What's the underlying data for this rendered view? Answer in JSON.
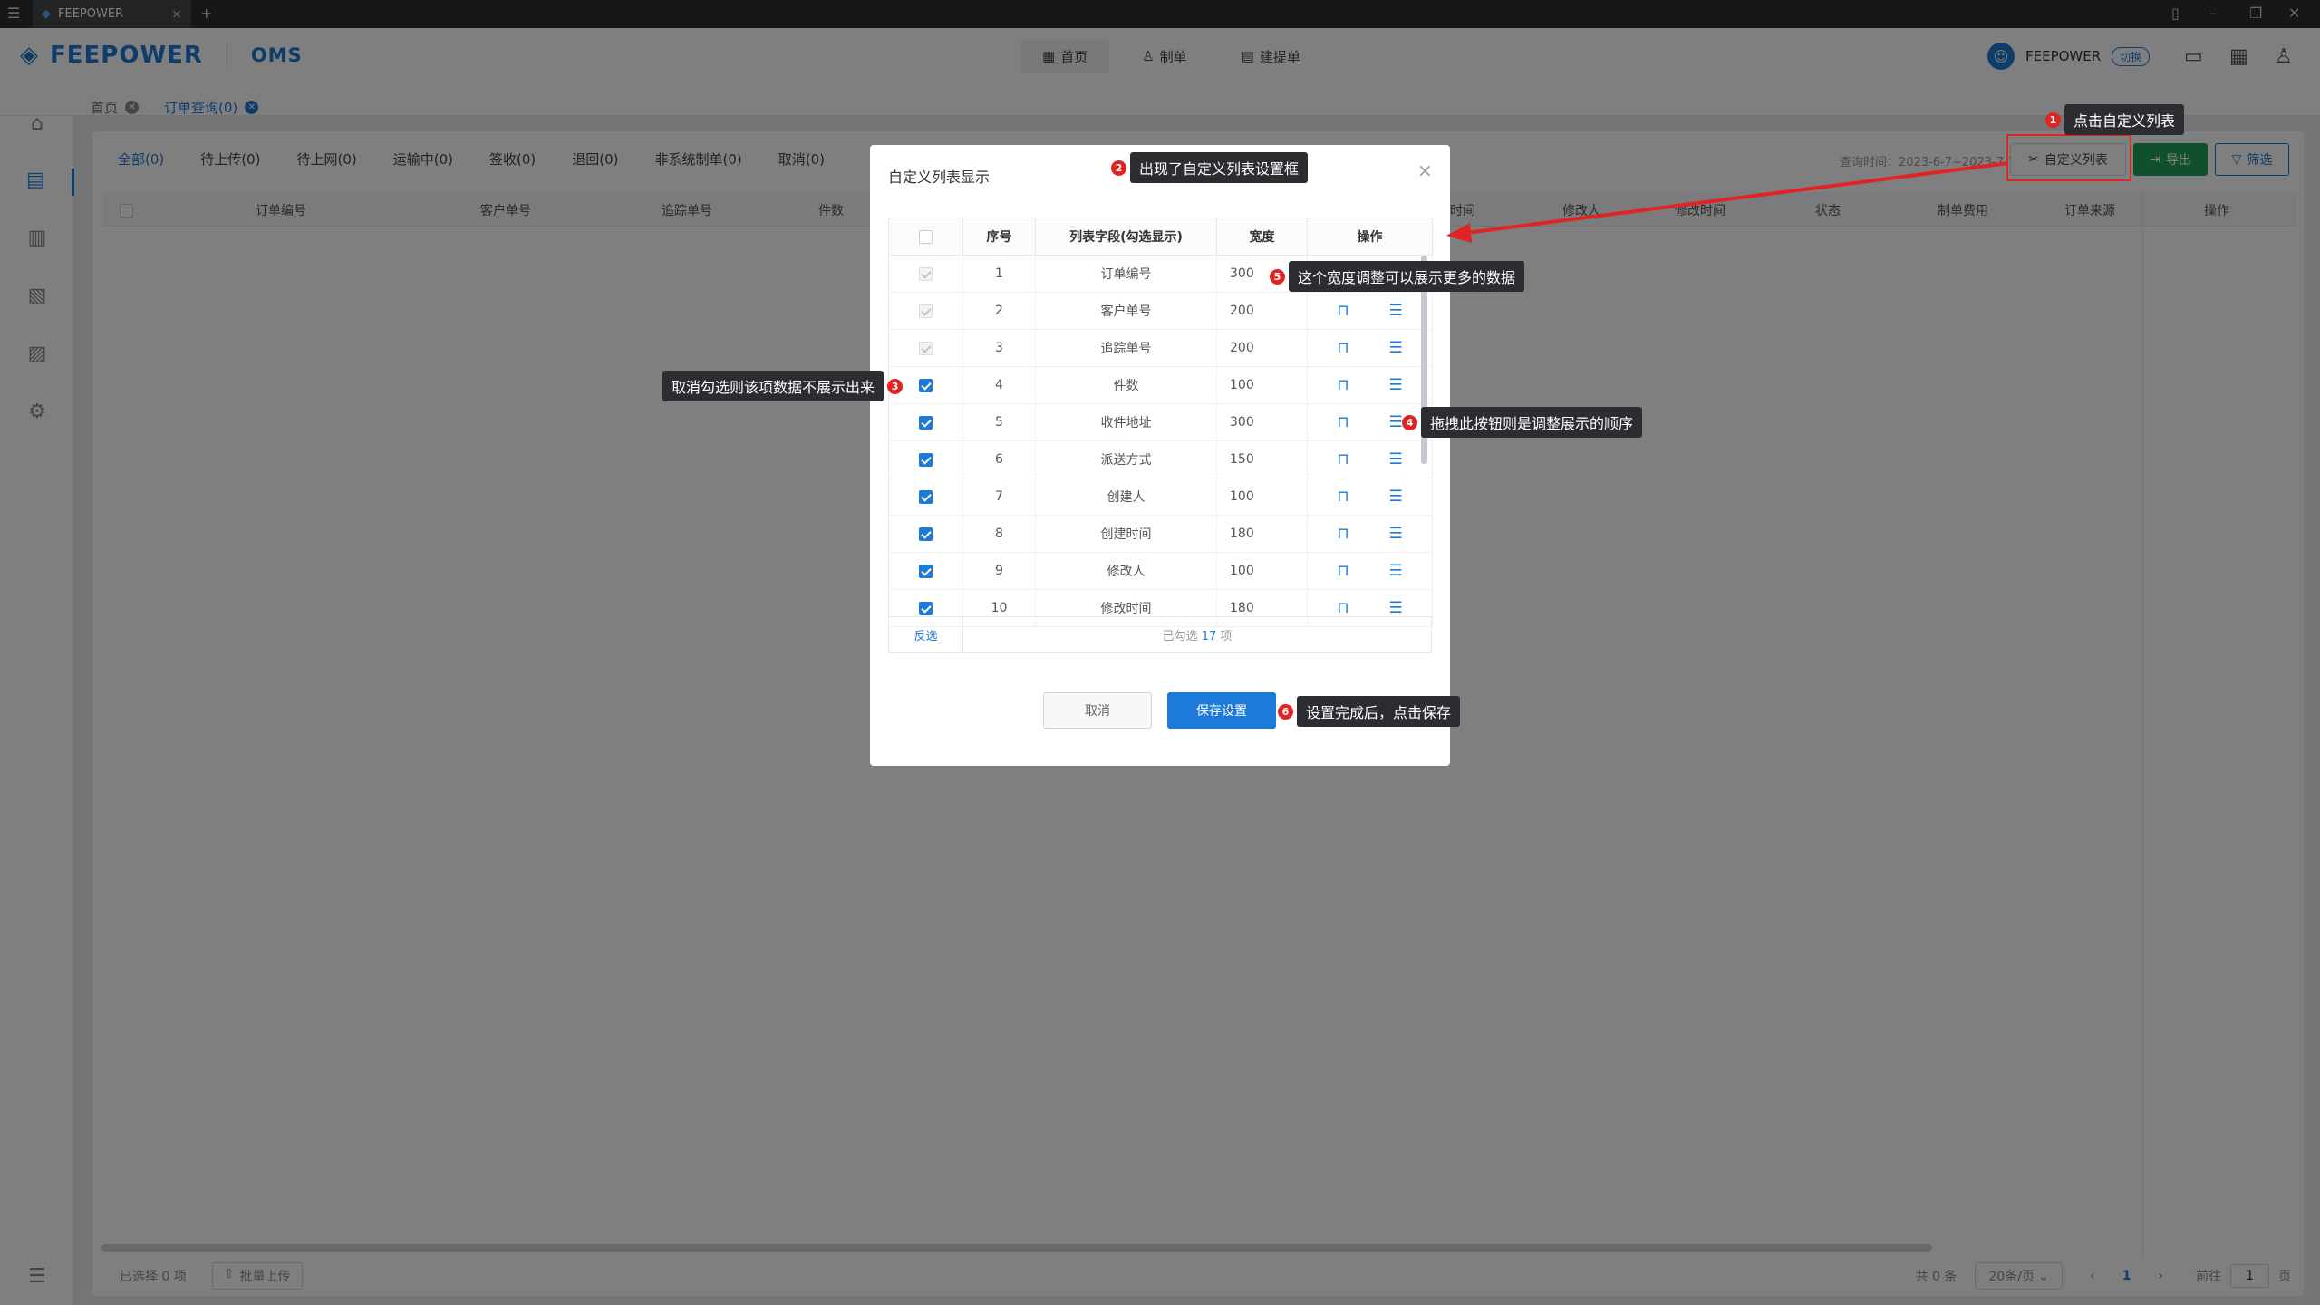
{
  "titlebar": {
    "tab_title": "FEEPOWER",
    "new_tab": "+"
  },
  "header": {
    "brand": "FEEPOWER",
    "app": "OMS",
    "nav": [
      {
        "label": "首页"
      },
      {
        "label": "制单"
      },
      {
        "label": "建提单"
      }
    ],
    "user": "FEEPOWER",
    "switch_label": "切换"
  },
  "breadcrumbs": [
    {
      "label": "首页"
    },
    {
      "label": "订单查询(0)"
    }
  ],
  "filters": [
    "全部(0)",
    "待上传(0)",
    "待上网(0)",
    "运输中(0)",
    "签收(0)",
    "退回(0)",
    "非系统制单(0)",
    "取消(0)"
  ],
  "toolbar": {
    "query_time": "查询时间：2023-6-7~2023-7-7",
    "custom_list": "自定义列表",
    "export": "导出",
    "filter": "筛选"
  },
  "table_headers": [
    "订单编号",
    "客户单号",
    "追踪单号",
    "件数",
    "时间",
    "修改人",
    "修改时间",
    "状态",
    "制单费用",
    "订单来源",
    "操作"
  ],
  "footer": {
    "selected": "已选择 0 项",
    "batch_upload": "批量上传",
    "total": "共 0 条",
    "page_size": "20条/页",
    "current_page": "1",
    "goto": "前往",
    "goto_value": "1",
    "page_suffix": "页"
  },
  "modal": {
    "title": "自定义列表显示",
    "columns": [
      "序号",
      "列表字段(勾选显示)",
      "宽度",
      "操作"
    ],
    "rows": [
      {
        "no": "1",
        "field": "订单编号",
        "width": "300",
        "state": "disabled"
      },
      {
        "no": "2",
        "field": "客户单号",
        "width": "200",
        "state": "disabled"
      },
      {
        "no": "3",
        "field": "追踪单号",
        "width": "200",
        "state": "disabled"
      },
      {
        "no": "4",
        "field": "件数",
        "width": "100",
        "state": "checked"
      },
      {
        "no": "5",
        "field": "收件地址",
        "width": "300",
        "state": "checked"
      },
      {
        "no": "6",
        "field": "派送方式",
        "width": "150",
        "state": "checked"
      },
      {
        "no": "7",
        "field": "创建人",
        "width": "100",
        "state": "checked"
      },
      {
        "no": "8",
        "field": "创建时间",
        "width": "180",
        "state": "checked"
      },
      {
        "no": "9",
        "field": "修改人",
        "width": "100",
        "state": "checked"
      },
      {
        "no": "10",
        "field": "修改时间",
        "width": "180",
        "state": "checked"
      }
    ],
    "invert": "反选",
    "selected_prefix": "已勾选",
    "selected_count": "17",
    "selected_suffix": "项",
    "cancel": "取消",
    "save": "保存设置"
  },
  "annotations": [
    {
      "n": "1",
      "text": "点击自定义列表"
    },
    {
      "n": "2",
      "text": "出现了自定义列表设置框"
    },
    {
      "n": "3",
      "text": "取消勾选则该项数据不展示出来"
    },
    {
      "n": "4",
      "text": "拖拽此按钮则是调整展示的顺序"
    },
    {
      "n": "5",
      "text": "这个宽度调整可以展示更多的数据"
    },
    {
      "n": "6",
      "text": "设置完成后，点击保存"
    }
  ],
  "colors": {
    "accent": "#1d7ad8",
    "export": "#20a05a",
    "annotation": "#e02424"
  }
}
